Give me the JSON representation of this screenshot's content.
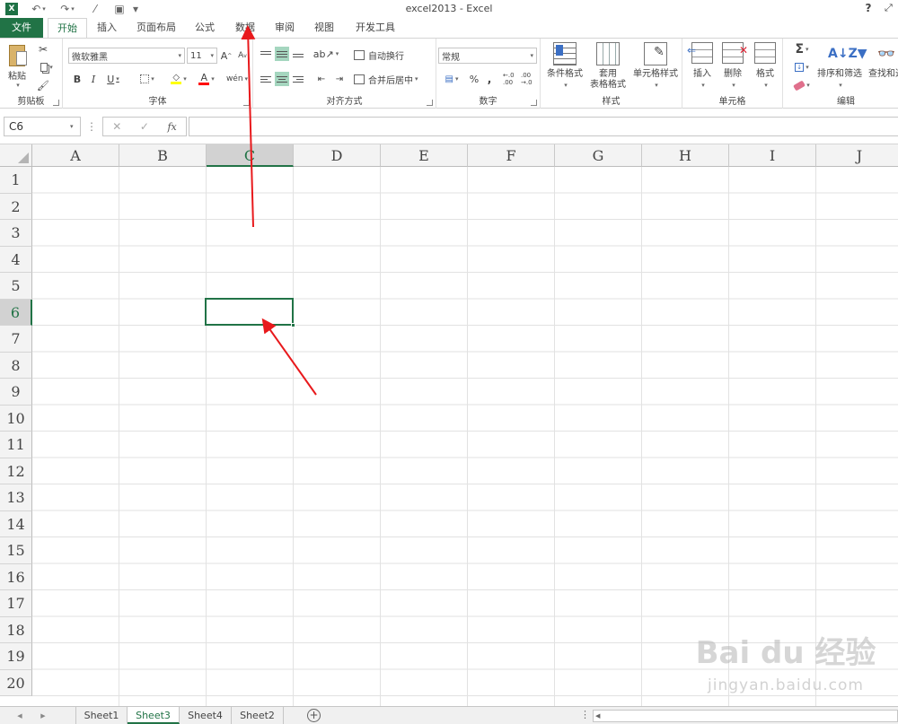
{
  "titlebar": {
    "app_icon": "X",
    "undo_icon": "undo-icon",
    "redo_icon": "redo-icon",
    "title": "excel2013 - Excel",
    "help": "?",
    "ribbon_options": "⤢"
  },
  "tabs": {
    "file": "文件",
    "home": "开始",
    "insert": "插入",
    "layout": "页面布局",
    "formulas": "公式",
    "data": "数据",
    "review": "审阅",
    "view": "视图",
    "developer": "开发工具"
  },
  "ribbon": {
    "clipboard": {
      "label": "剪贴板",
      "paste": "粘贴"
    },
    "font": {
      "label": "字体",
      "name": "微软雅黑",
      "size": "11",
      "bold": "B",
      "italic": "I",
      "underline": "U",
      "grow": "A",
      "shrink": "A",
      "fill_glyph": "◇",
      "font_color_glyph": "A",
      "phonetic": "wén"
    },
    "alignment": {
      "label": "对齐方式",
      "wrap_text": "自动换行",
      "merge_center": "合并后居中"
    },
    "number": {
      "label": "数字",
      "format": "常规",
      "percent": "%",
      "comma": ",",
      "inc_decimal": "←.0 .00",
      "dec_decimal": ".00 →.0"
    },
    "styles": {
      "label": "样式",
      "conditional_format": "条件格式",
      "format_table_1": "套用",
      "format_table_2": "表格格式",
      "cell_styles": "单元格样式"
    },
    "cells": {
      "label": "单元格",
      "insert": "插入",
      "delete": "删除",
      "format": "格式"
    },
    "editing": {
      "label": "编辑",
      "autosum": "Σ",
      "sort_filter": "排序和筛选",
      "find_select": "查找和选"
    }
  },
  "formula_bar": {
    "name_box": "C6",
    "cancel": "✕",
    "enter": "✓",
    "function": "fx",
    "value": ""
  },
  "grid": {
    "columns": [
      "A",
      "B",
      "C",
      "D",
      "E",
      "F",
      "G",
      "H",
      "I",
      "J"
    ],
    "rows": [
      "1",
      "2",
      "3",
      "4",
      "5",
      "6",
      "7",
      "8",
      "9",
      "10",
      "11",
      "12",
      "13",
      "14",
      "15",
      "16",
      "17",
      "18",
      "19",
      "20"
    ],
    "active_column": "C",
    "active_row": "6"
  },
  "sheets": {
    "tabs": [
      "Sheet1",
      "Sheet3",
      "Sheet4",
      "Sheet2"
    ],
    "active": "Sheet3"
  },
  "watermark": {
    "brand": "Bai du 经验",
    "url": "jingyan.baidu.com"
  },
  "colors": {
    "excel_green": "#217346",
    "arrow_red": "#e8191c"
  }
}
